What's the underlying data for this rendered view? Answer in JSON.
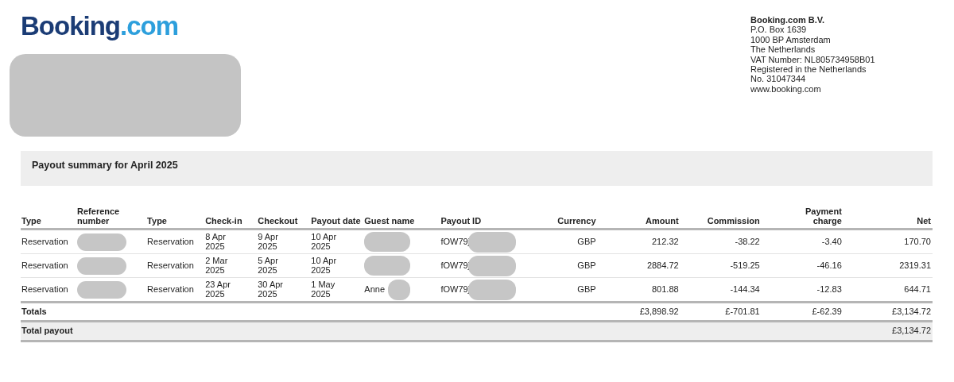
{
  "logo": {
    "name": "Booking",
    "suffix": ".com"
  },
  "recipient": {
    "redacted": true
  },
  "company": {
    "name": "Booking.com B.V.",
    "lines": [
      "P.O. Box 1639",
      "1000 BP Amsterdam",
      "The Netherlands",
      "VAT Number: NL805734958B01",
      "Registered in the Netherlands",
      "No. 31047344",
      "www.booking.com"
    ]
  },
  "summary": {
    "title": "Payout summary for April 2025"
  },
  "table": {
    "columns": [
      {
        "label": "Type",
        "kind": "text"
      },
      {
        "label": "Reference number",
        "kind": "text"
      },
      {
        "label": "Type",
        "kind": "text"
      },
      {
        "label": "Check-in",
        "kind": "date"
      },
      {
        "label": "Checkout",
        "kind": "date"
      },
      {
        "label": "Payout date",
        "kind": "date"
      },
      {
        "label": "Guest name",
        "kind": "text"
      },
      {
        "label": "Payout ID",
        "kind": "text"
      },
      {
        "label": "Currency",
        "kind": "numeric"
      },
      {
        "label": "Amount",
        "kind": "numeric"
      },
      {
        "label": "Commission",
        "kind": "numeric"
      },
      {
        "label": "Payment charge",
        "kind": "numeric"
      },
      {
        "label": "Net",
        "kind": "numeric"
      }
    ],
    "rows": [
      {
        "cells": [
          {
            "text": "Reservation",
            "redacted": false
          },
          {
            "redacted": true
          },
          {
            "text": "Reservation",
            "redacted": false
          },
          {
            "text": "8 Apr 2025",
            "redacted": false
          },
          {
            "text": "9 Apr 2025",
            "redacted": false
          },
          {
            "text": "10 Apr 2025",
            "redacted": false
          },
          {
            "redacted": true
          },
          {
            "text": "fOW79j",
            "redacted": true
          },
          {
            "text": "GBP",
            "redacted": false
          },
          {
            "text": "212.32",
            "redacted": false
          },
          {
            "text": "-38.22",
            "redacted": false
          },
          {
            "text": "-3.40",
            "redacted": false
          },
          {
            "text": "170.70",
            "redacted": false
          }
        ]
      },
      {
        "cells": [
          {
            "text": "Reservation",
            "redacted": false
          },
          {
            "redacted": true
          },
          {
            "text": "Reservation",
            "redacted": false
          },
          {
            "text": "2 Mar 2025",
            "redacted": false
          },
          {
            "text": "5 Apr 2025",
            "redacted": false
          },
          {
            "text": "10 Apr 2025",
            "redacted": false
          },
          {
            "redacted": true
          },
          {
            "text": "fOW79j",
            "redacted": true
          },
          {
            "text": "GBP",
            "redacted": false
          },
          {
            "text": "2884.72",
            "redacted": false
          },
          {
            "text": "-519.25",
            "redacted": false
          },
          {
            "text": "-46.16",
            "redacted": false
          },
          {
            "text": "2319.31",
            "redacted": false
          }
        ]
      },
      {
        "cells": [
          {
            "text": "Reservation",
            "redacted": false
          },
          {
            "redacted": true
          },
          {
            "text": "Reservation",
            "redacted": false
          },
          {
            "text": "23 Apr 2025",
            "redacted": false
          },
          {
            "text": "30 Apr 2025",
            "redacted": false
          },
          {
            "text": "1 May 2025",
            "redacted": false
          },
          {
            "text": "Anne",
            "redacted": true
          },
          {
            "text": "fOW79j",
            "redacted": true
          },
          {
            "text": "GBP",
            "redacted": false
          },
          {
            "text": "801.88",
            "redacted": false
          },
          {
            "text": "-144.34",
            "redacted": false
          },
          {
            "text": "-12.83",
            "redacted": false
          },
          {
            "text": "644.71",
            "redacted": false
          }
        ]
      }
    ],
    "totals": {
      "label": "Totals",
      "amount": "£3,898.92",
      "commission": "£-701.81",
      "payment_charge": "£-62.39",
      "net": "£3,134.72"
    },
    "total_payout": {
      "label": "Total payout",
      "net": "£3,134.72"
    }
  }
}
